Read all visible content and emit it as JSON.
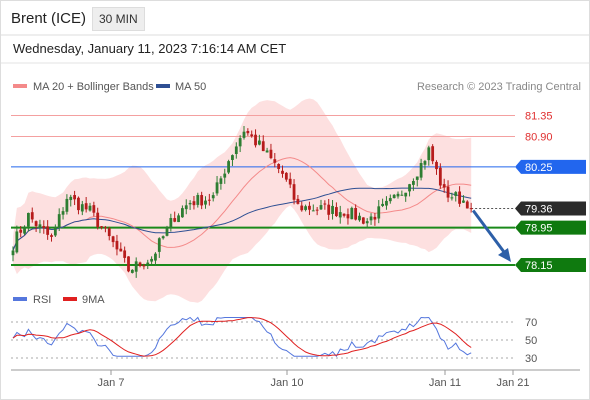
{
  "header": {
    "title": "Brent (ICE)",
    "interval": "30 MIN",
    "timestamp": "Wednesday, January 11, 2023 7:16:14 AM CET"
  },
  "colors": {
    "bollinger": "#f48a8a",
    "ma50": "#2e4f93",
    "rsi": "#5577dd",
    "rsi_ma": "#e02020",
    "up_candle": "#2e7d32",
    "down_candle": "#b71c1c",
    "support": "#1a8a1a",
    "resistance_line": "#f4a0a0",
    "pivot": "#2266ee",
    "arrow": "#2c5fa8"
  },
  "chart_data": [
    {
      "type": "candlestick",
      "title": "Brent (ICE)",
      "legend": [
        {
          "name": "MA 20 + Bollinger Bands",
          "color": "#f48a8a"
        },
        {
          "name": "MA 50",
          "color": "#2e4f93"
        }
      ],
      "copyright": "Research © 2023 Trading Central",
      "x_ticks": [
        "Jan 7",
        "Jan 10",
        "Jan 11",
        "Jan 21"
      ],
      "ylim": [
        78.0,
        81.8
      ],
      "levels": [
        {
          "value": 81.35,
          "label": "81.35",
          "style": "resistance"
        },
        {
          "value": 80.9,
          "label": "80.90",
          "style": "resistance"
        },
        {
          "value": 80.25,
          "label": "80.25",
          "style": "pivot"
        },
        {
          "value": 79.36,
          "label": "79.36",
          "style": "last"
        },
        {
          "value": 78.95,
          "label": "78.95",
          "style": "support"
        },
        {
          "value": 78.15,
          "label": "78.15",
          "style": "support"
        }
      ],
      "forecast_arrow": {
        "from": 79.36,
        "to": 78.15
      },
      "last_price": 79.36
    },
    {
      "type": "line",
      "legend": [
        {
          "name": "RSI",
          "color": "#5577dd"
        },
        {
          "name": "9MA",
          "color": "#e02020"
        }
      ],
      "y_ticks": [
        "70",
        "50",
        "30"
      ],
      "ylim": [
        20,
        85
      ]
    }
  ]
}
